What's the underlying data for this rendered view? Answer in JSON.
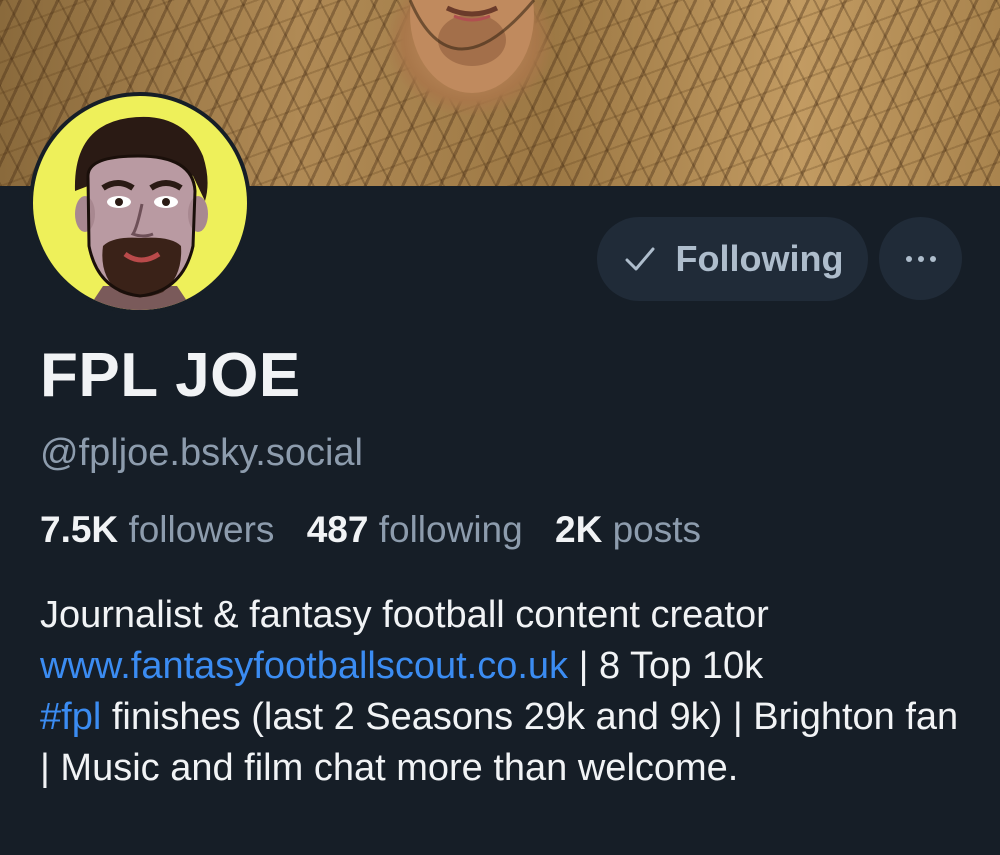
{
  "profile": {
    "display_name": "FPL JOE",
    "handle": "@fpljoe.bsky.social",
    "banner_icon": "face-artwork-banner",
    "avatar_icon": "cartoon-man-avatar"
  },
  "actions": {
    "following_label": "Following",
    "following_icon": "checkmark-icon",
    "more_icon": "ellipsis-icon"
  },
  "stats": {
    "followers_count": "7.5K",
    "followers_label": "followers",
    "following_count": "487",
    "following_label": "following",
    "posts_count": "2K",
    "posts_label": "posts"
  },
  "bio": {
    "line1": "Journalist & fantasy football content creator",
    "link_url": "www.fantasyfootballscout.co.uk",
    "after_link": " | 8 Top 10k ",
    "hashtag": "#fpl",
    "after_hashtag": " finishes (last 2 Seasons 29k and 9k) | Brighton fan | Music and film chat more than welcome."
  },
  "colors": {
    "background": "#161e27",
    "button_bg": "#202b38",
    "link": "#3b8cf2",
    "secondary_text": "#8d9cad",
    "primary_text": "#f1f3f5",
    "avatar_bg": "#eef05a"
  }
}
